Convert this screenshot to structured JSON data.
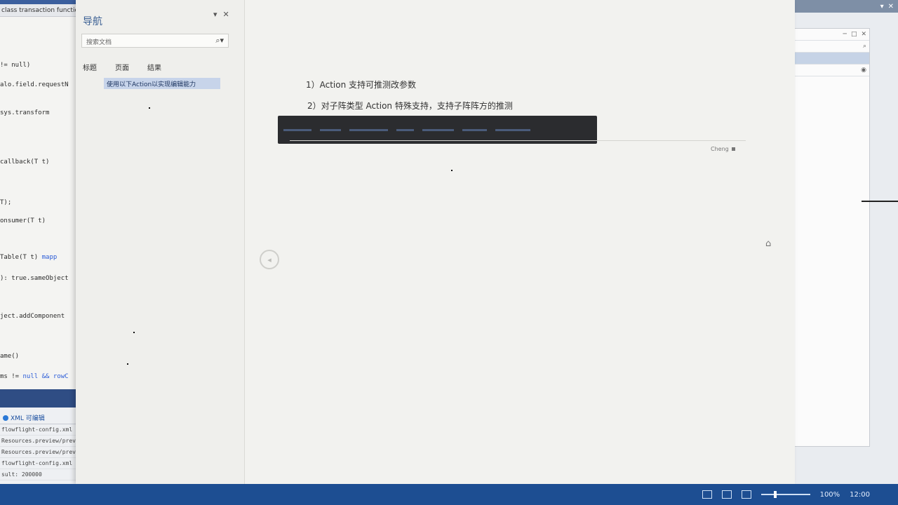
{
  "ide": {
    "tab": "class transaction functions Ma",
    "code_lines": [
      {
        "text": "!= null)",
        "kw": ""
      },
      {
        "text": "alo.field.requestN",
        "kw": ""
      },
      {
        "text": "sys.transform",
        "kw": ""
      },
      {
        "text": "callback(T t)",
        "kw": ""
      },
      {
        "text": "T);",
        "kw": ""
      },
      {
        "text": "onsumer(T t)",
        "kw": ""
      },
      {
        "text": "Table(T t) ",
        "kw": "mapp"
      },
      {
        "text": "): true.sameObject",
        "kw": ""
      },
      {
        "text": "ject.addComponent",
        "kw": ""
      },
      {
        "text": "ame()",
        "kw": ""
      },
      {
        "text": "ms != ",
        "kw": "null && rowC"
      }
    ],
    "output_title": "XML 可编辑",
    "output_lines": [
      "flowflight-config.xml fil",
      "Resources.preview/previe",
      "Resources.preview/previe",
      "flowflight-config.xml fil",
      "sult: 200000"
    ]
  },
  "nav": {
    "title": "导航",
    "controls": [
      "▾",
      "✕"
    ],
    "search_value": "搜索文档",
    "tabs": [
      "标题",
      "页面",
      "结果"
    ],
    "result_item": "使用以下Action以实现编辑能力"
  },
  "doc": {
    "step1": "1）Action 支持可推测改参数",
    "step2": "2）对子阵类型 Action 特殊支持，支持子阵阵方的推测",
    "page_label": "Cheng",
    "circle_glyph": "◂"
  },
  "rightwin": {
    "strip_buttons": [
      "▾",
      "✕"
    ],
    "window_buttons": [
      "─",
      "□",
      "✕"
    ],
    "search_icon": "search-icon"
  },
  "taskbar": {
    "zoom": "100%",
    "tray_time": "12:00"
  },
  "colors": {
    "accent": "#2f4d84",
    "taskbar": "#1d4e92",
    "selection": "#c7d4ea"
  }
}
